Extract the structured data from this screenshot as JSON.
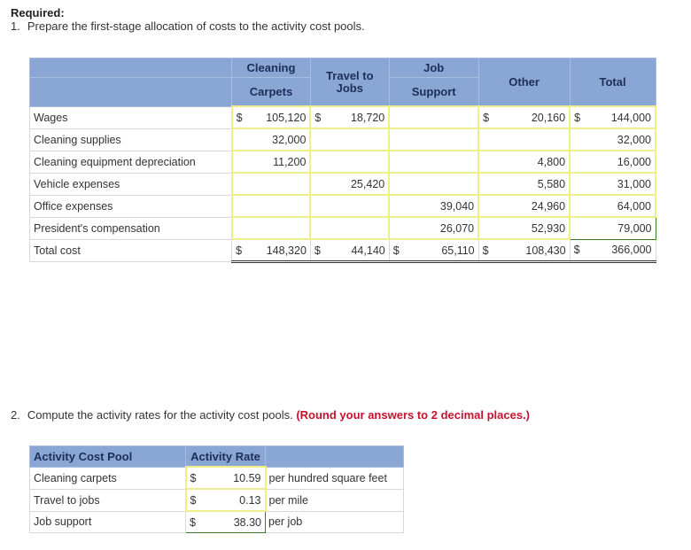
{
  "required_label": "Required:",
  "question1": {
    "number": "1.",
    "text": "Prepare the first-stage allocation of costs to the activity cost pools."
  },
  "allocation_table": {
    "headers": {
      "cleaning_carpets_line1": "Cleaning",
      "cleaning_carpets_line2": "Carpets",
      "travel_to_jobs_line1": "Travel to",
      "travel_to_jobs_line2": "Jobs",
      "job_support_line1": "Job",
      "job_support_line2": "Support",
      "other": "Other",
      "total": "Total"
    },
    "rows": [
      {
        "label": "Wages",
        "cleaning_carpets": "105,120",
        "travel_to_jobs": "18,720",
        "job_support": "",
        "other": "20,160",
        "total": "144,000",
        "cc_cur": "$",
        "tj_cur": "$",
        "js_cur": "",
        "ot_cur": "$",
        "tot_cur": "$"
      },
      {
        "label": "Cleaning supplies",
        "cleaning_carpets": "32,000",
        "travel_to_jobs": "",
        "job_support": "",
        "other": "",
        "total": "32,000"
      },
      {
        "label": "Cleaning equipment depreciation",
        "cleaning_carpets": "11,200",
        "travel_to_jobs": "",
        "job_support": "",
        "other": "4,800",
        "total": "16,000"
      },
      {
        "label": "Vehicle expenses",
        "cleaning_carpets": "",
        "travel_to_jobs": "25,420",
        "job_support": "",
        "other": "5,580",
        "total": "31,000"
      },
      {
        "label": "Office expenses",
        "cleaning_carpets": "",
        "travel_to_jobs": "",
        "job_support": "39,040",
        "other": "24,960",
        "total": "64,000"
      },
      {
        "label": "President's compensation",
        "cleaning_carpets": "",
        "travel_to_jobs": "",
        "job_support": "26,070",
        "other": "52,930",
        "total": "79,000"
      },
      {
        "label": "Total cost",
        "cleaning_carpets": "148,320",
        "travel_to_jobs": "44,140",
        "job_support": "65,110",
        "other": "108,430",
        "total": "366,000",
        "cc_cur": "$",
        "tj_cur": "$",
        "js_cur": "$",
        "ot_cur": "$",
        "tot_cur": "$"
      }
    ]
  },
  "question2": {
    "number": "2.",
    "text": "Compute the activity rates for the activity cost pools.",
    "note": "(Round your answers to 2 decimal places.)"
  },
  "rates_table": {
    "headers": {
      "pool": "Activity Cost Pool",
      "rate": "Activity Rate",
      "unit": ""
    },
    "rows": [
      {
        "pool": "Cleaning carpets",
        "currency": "$",
        "rate": "10.59",
        "unit": "per hundred square feet"
      },
      {
        "pool": "Travel to jobs",
        "currency": "$",
        "rate": "0.13",
        "unit": "per mile"
      },
      {
        "pool": "Job support",
        "currency": "$",
        "rate": "38.30",
        "unit": "per job"
      }
    ]
  },
  "colors": {
    "header_bg": "#8aa6d5",
    "input_border": "#f0ee8a",
    "active_border": "#3a7d1a",
    "note_red": "#c8102e"
  }
}
